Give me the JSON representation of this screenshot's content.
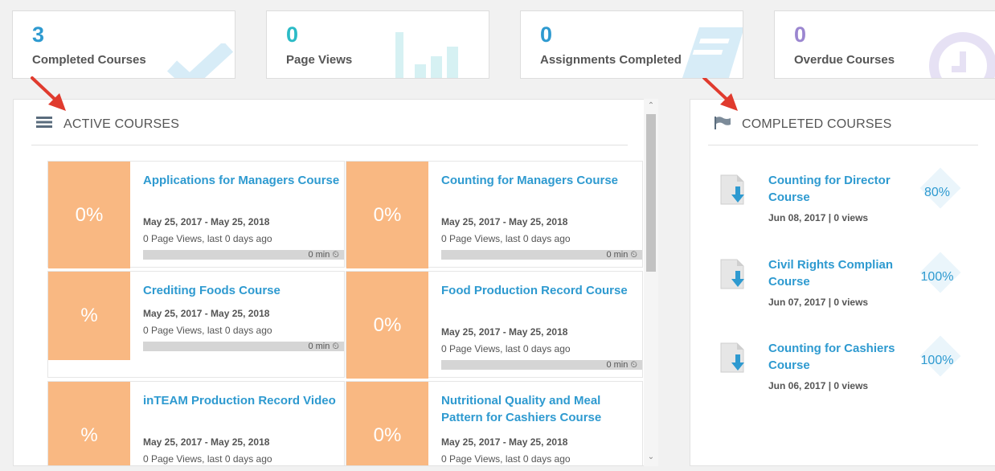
{
  "stats": [
    {
      "value": "3",
      "label": "Completed Courses",
      "color": "#2e9ad0",
      "icon": "checkmark-icon"
    },
    {
      "value": "0",
      "label": "Page Views",
      "color": "#2bbbc6",
      "icon": "bar-chart-icon"
    },
    {
      "value": "0",
      "label": "Assignments Completed",
      "color": "#2e9ad0",
      "icon": "document-icon"
    },
    {
      "value": "0",
      "label": "Overdue Courses",
      "color": "#9b86d0",
      "icon": "clock-icon"
    }
  ],
  "active": {
    "title": "ACTIVE COURSES",
    "icon": "list-icon",
    "courses": [
      {
        "pct": "0%",
        "title": "Applications for Managers Course",
        "date": "May 25, 2017 - May 25, 2018",
        "views": "0 Page Views, last 0 days ago",
        "time": "0 min"
      },
      {
        "pct": "0%",
        "title": "Counting for Managers Course",
        "date": "May 25, 2017 - May 25, 2018",
        "views": "0 Page Views, last 0 days ago",
        "time": "0 min"
      },
      {
        "pct": "%",
        "title": "Crediting Foods Course",
        "date": "May 25, 2017 - May 25, 2018",
        "views": "0 Page Views, last 0 days ago",
        "time": "0 min"
      },
      {
        "pct": "0%",
        "title": "Food Production Record Course",
        "date": "May 25, 2017 - May 25, 2018",
        "views": "0 Page Views, last 0 days ago",
        "time": "0 min"
      },
      {
        "pct": "%",
        "title": "inTEAM Production Record Video",
        "date": "May 25, 2017 - May 25, 2018",
        "views": "0 Page Views, last 0 days ago",
        "time": ""
      },
      {
        "pct": "0%",
        "title": "Nutritional Quality and Meal Pattern for Cashiers Course",
        "date": "May 25, 2017 - May 25, 2018",
        "views": "0 Page Views, last 0 days ago",
        "time": ""
      }
    ]
  },
  "completed": {
    "title": "COMPLETED COURSES",
    "icon": "flag-icon",
    "courses": [
      {
        "title1": "Counting for Director",
        "title2": "Course",
        "meta": "Jun 08, 2017 | 0 views",
        "pct": "80%"
      },
      {
        "title1": "Civil Rights Complian",
        "title2": "Course",
        "meta": "Jun 07, 2017 | 0 views",
        "pct": "100%"
      },
      {
        "title1": "Counting for Cashiers",
        "title2": "Course",
        "meta": "Jun 06, 2017 | 0 views",
        "pct": "100%"
      }
    ]
  },
  "colors": {
    "accent": "#2e9ad0",
    "pct_bg": "#f9b882",
    "arrow": "#e03b2e"
  }
}
